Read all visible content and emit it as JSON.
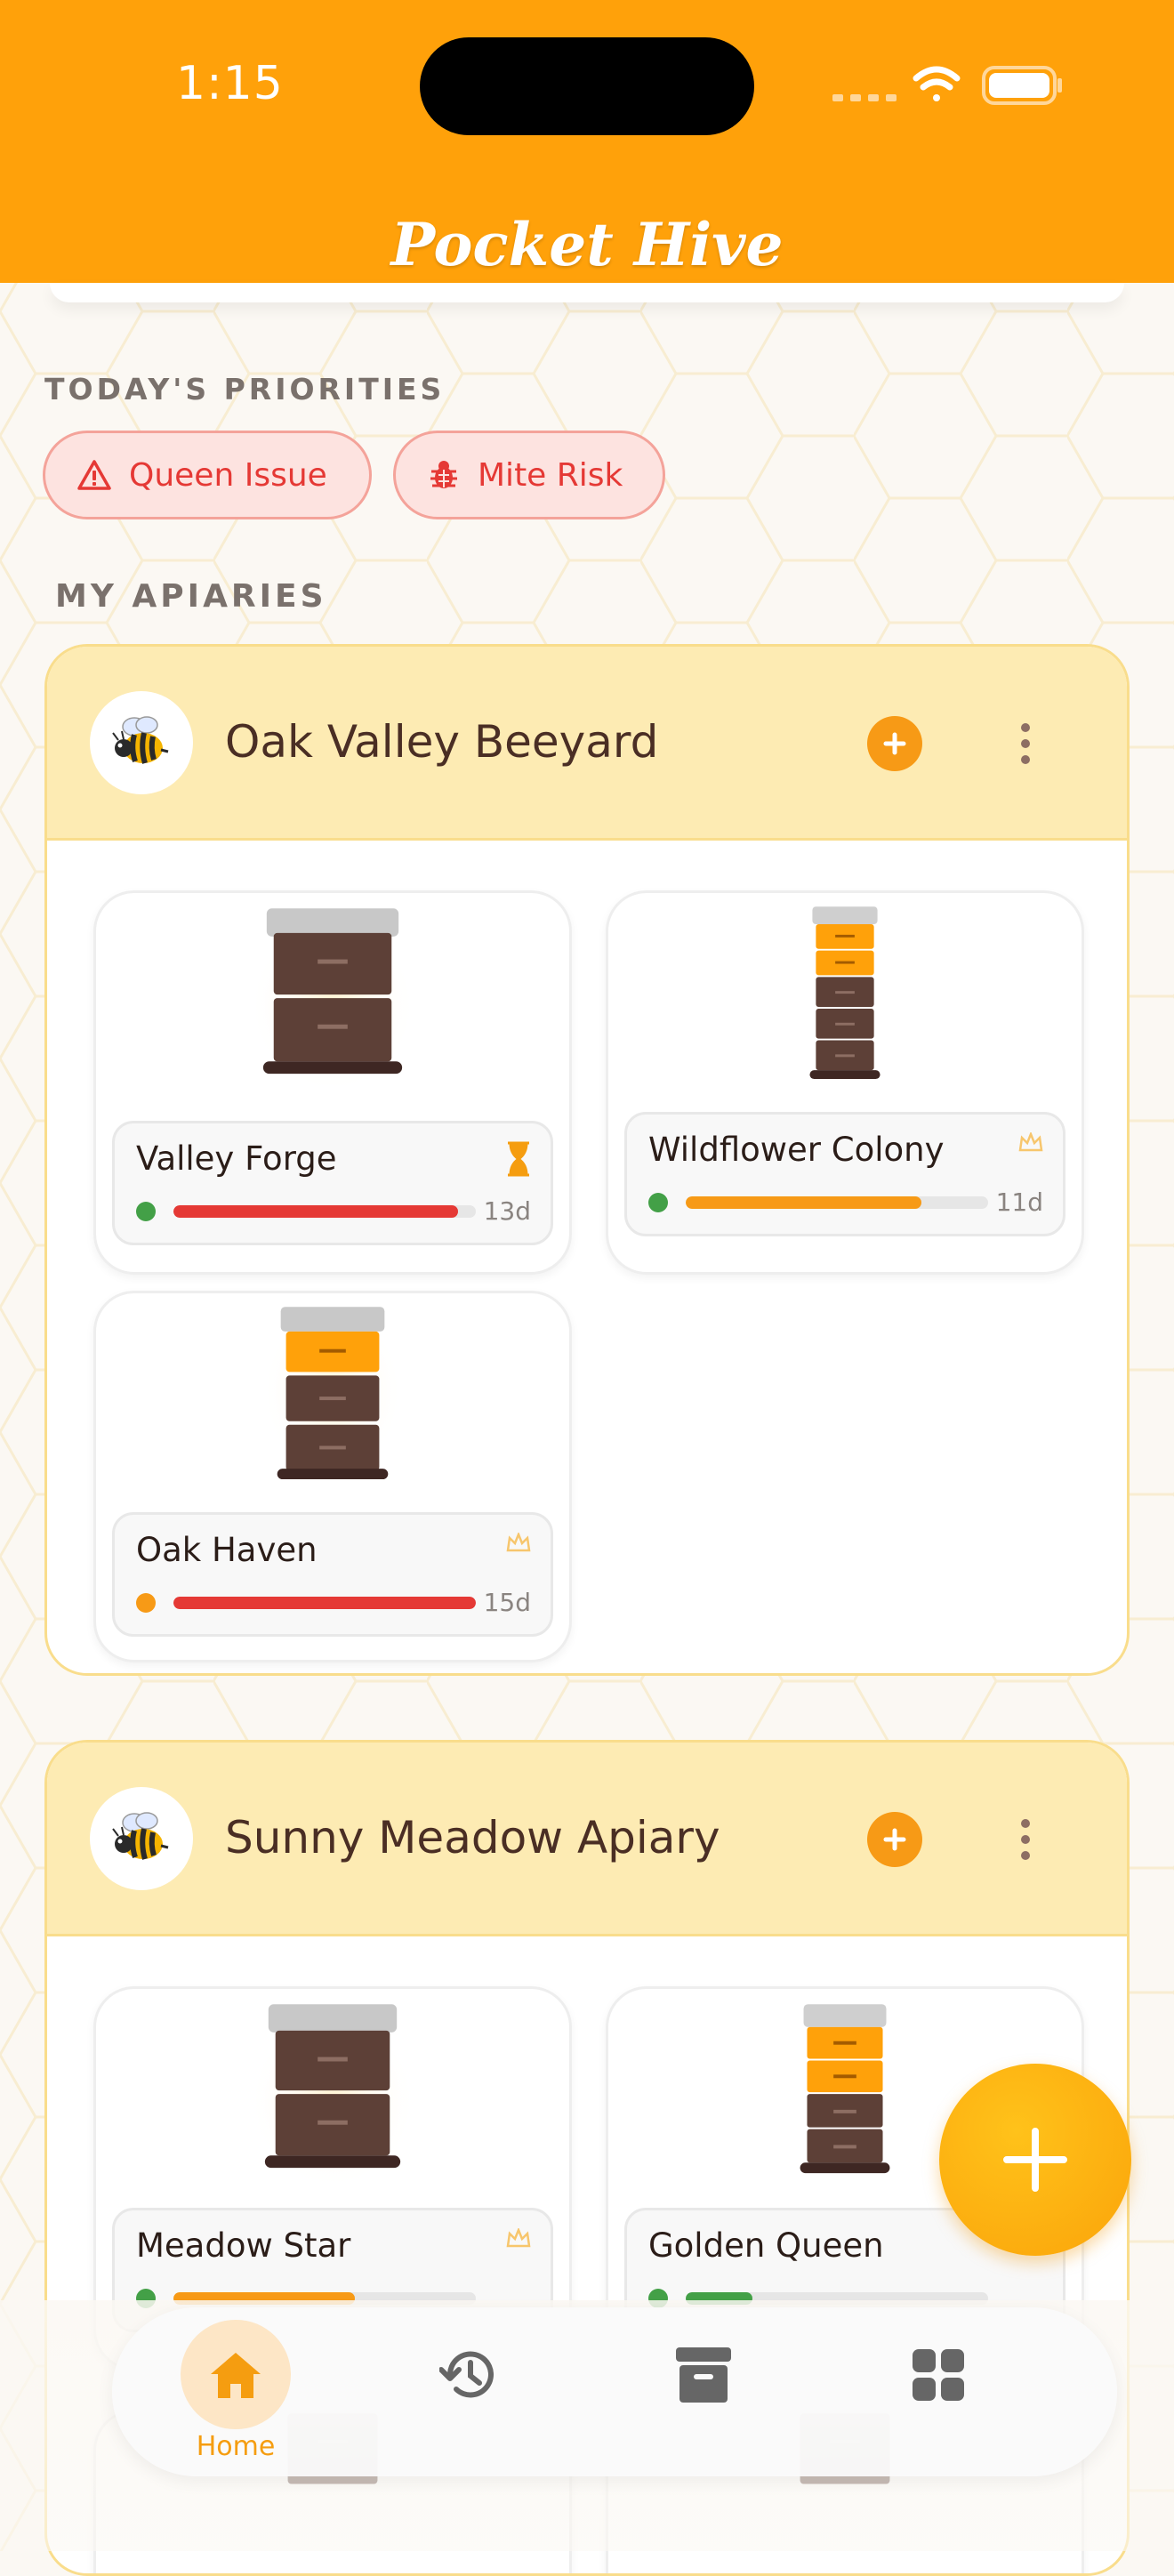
{
  "status_bar": {
    "time": "1:15"
  },
  "app": {
    "title": "Pocket Hive"
  },
  "priorities": {
    "label": "TODAY'S PRIORITIES",
    "items": [
      {
        "label": "Queen Issue",
        "icon": "warning-icon"
      },
      {
        "label": "Mite Risk",
        "icon": "bug-icon"
      }
    ]
  },
  "apiaries_label": "MY APIARIES",
  "apiaries": [
    {
      "name": "Oak Valley Beeyard",
      "avatar": "bee-icon",
      "hives": [
        {
          "name": "Valley Forge",
          "days": "13d",
          "status_icon": "hourglass-icon",
          "dot_color": "#43a047",
          "progress": 0.94,
          "bar_color": "#e53935"
        },
        {
          "name": "Wildflower Colony",
          "days": "11d",
          "status_icon": "crown-icon",
          "dot_color": "#43a047",
          "progress": 0.78,
          "bar_color": "#f79a16"
        },
        {
          "name": "Oak Haven",
          "days": "15d",
          "status_icon": "crown-icon",
          "dot_color": "#f79a16",
          "progress": 1.0,
          "bar_color": "#e53935"
        }
      ]
    },
    {
      "name": "Sunny Meadow Apiary",
      "avatar": "bee-icon",
      "hives": [
        {
          "name": "Meadow Star",
          "status_icon": "crown-icon",
          "dot_color": "#43a047",
          "progress": 0.6,
          "bar_color": "#f79a16"
        },
        {
          "name": "Golden Queen",
          "status_icon": "crown-icon",
          "dot_color": "#43a047",
          "progress": 0.22,
          "bar_color": "#43a047"
        }
      ]
    }
  ],
  "nav": {
    "items": [
      {
        "label": "Home",
        "icon": "home-icon",
        "active": true
      },
      {
        "label": "",
        "icon": "history-icon",
        "active": false
      },
      {
        "label": "",
        "icon": "archive-icon",
        "active": false
      },
      {
        "label": "",
        "icon": "grid-icon",
        "active": false
      }
    ]
  },
  "colors": {
    "accent": "#ffa10a",
    "danger": "#e53935",
    "panel": "#fdebb3"
  }
}
